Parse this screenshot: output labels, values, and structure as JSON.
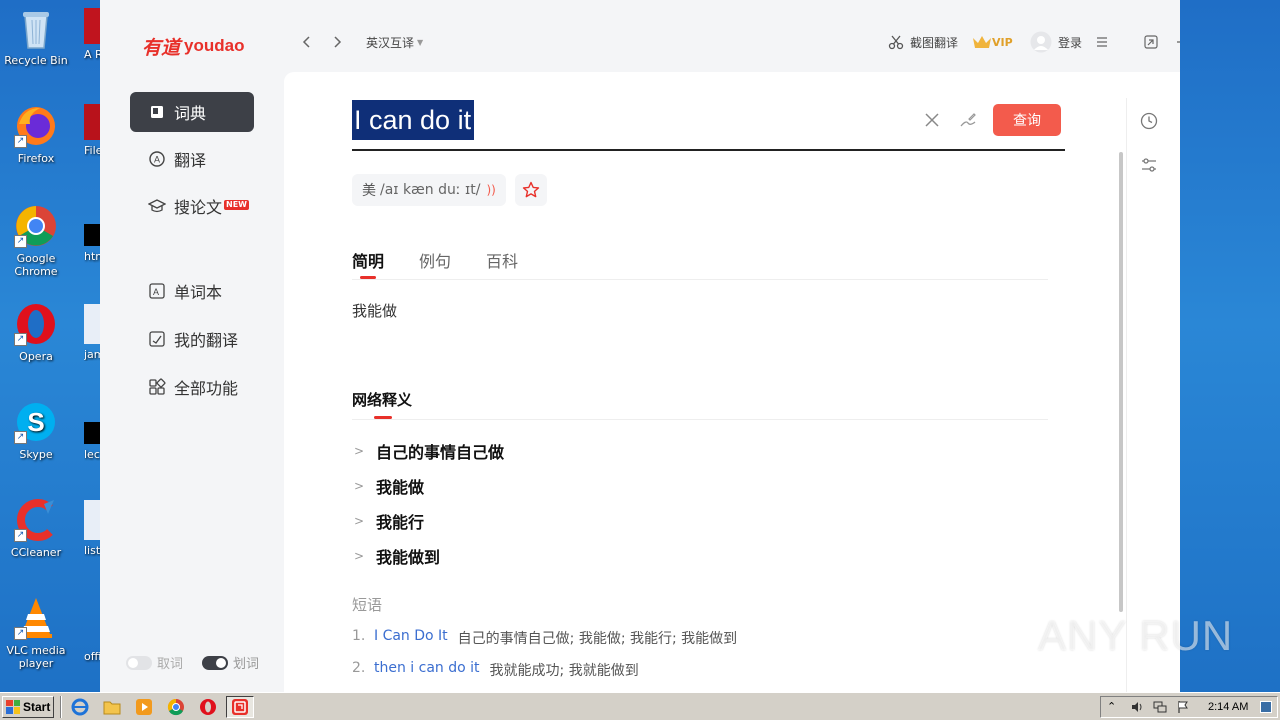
{
  "desktop": {
    "icons": [
      {
        "label": "Recycle Bin",
        "icon": "recycle-bin-icon"
      },
      {
        "label": "Firefox",
        "icon": "firefox-icon"
      },
      {
        "label": "Google Chrome",
        "icon": "chrome-icon"
      },
      {
        "label": "Opera",
        "icon": "opera-icon"
      },
      {
        "label": "Skype",
        "icon": "skype-icon"
      },
      {
        "label": "CCleaner",
        "icon": "ccleaner-icon"
      },
      {
        "label": "VLC media player",
        "icon": "vlc-icon"
      }
    ],
    "partial_icons": [
      "A Rea",
      "FileZ",
      "htm",
      "jame",
      "lec",
      "listed",
      "office"
    ]
  },
  "app": {
    "logo_cn": "有道",
    "logo_en": "youdao",
    "sidebar": {
      "items": [
        {
          "label": "词典",
          "icon": "dictionary-icon",
          "active": true
        },
        {
          "label": "翻译",
          "icon": "translate-icon"
        },
        {
          "label": "搜论文",
          "icon": "graduation-cap-icon",
          "badge": "NEW"
        },
        {
          "label": "单词本",
          "icon": "wordbook-icon"
        },
        {
          "label": "我的翻译",
          "icon": "my-translation-icon"
        },
        {
          "label": "全部功能",
          "icon": "all-features-icon"
        }
      ],
      "toggle_left": "取词",
      "toggle_right": "划词"
    },
    "topbar": {
      "mode": "英汉互译",
      "screenshot_translate": "截图翻译",
      "vip": "VIP",
      "login": "登录"
    },
    "search": {
      "query": "I can do it",
      "button": "查询"
    },
    "pronunciation": {
      "region": "美",
      "phonetic": "/aɪ kæn duː ɪt/"
    },
    "tabs": [
      "简明",
      "例句",
      "百科"
    ],
    "basic_meaning": "我能做",
    "web_section": {
      "title": "网络释义",
      "items": [
        "自己的事情自己做",
        "我能做",
        "我能行",
        "我能做到"
      ]
    },
    "phrases": {
      "title": "短语",
      "items": [
        {
          "num": "1.",
          "en": "I Can Do It",
          "cn": "自己的事情自己做; 我能做; 我能行; 我能做到"
        },
        {
          "num": "2.",
          "en": "then i can do it",
          "cn": "我就能成功; 我就能做到"
        }
      ]
    }
  },
  "watermark": "ANY RUN",
  "taskbar": {
    "start": "Start",
    "clock": "2:14 AM"
  },
  "colors": {
    "accent": "#f35b4c",
    "sidebar_active": "#3d4047",
    "link": "#3b6ed0",
    "selection": "#0f2f78"
  }
}
